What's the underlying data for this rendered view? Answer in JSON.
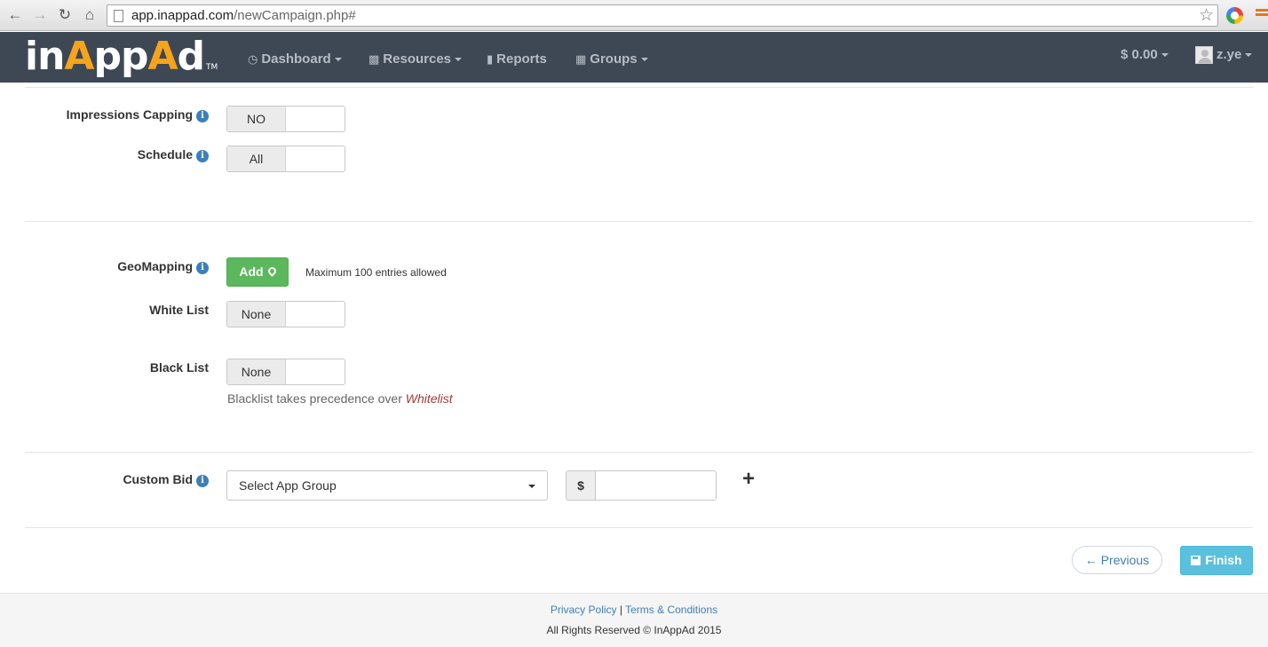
{
  "browser": {
    "url_host": "app.inappad.com",
    "url_path": "/newCampaign.php#"
  },
  "navbar": {
    "logo_prefix": "in",
    "logo_accent": "A",
    "logo_mid": "pp",
    "logo_accent2": "A",
    "logo_suffix": "d",
    "logo_tm": "TM",
    "items": [
      {
        "label": "Dashboard",
        "icon": "clock-icon"
      },
      {
        "label": "Resources",
        "icon": "book-icon"
      },
      {
        "label": "Reports",
        "icon": "bar-chart-icon"
      },
      {
        "label": "Groups",
        "icon": "grid-icon"
      }
    ],
    "balance": "$ 0.00",
    "username": "z.ye",
    "colors": {
      "bar": "#3e4855",
      "accent": "#f5a41b"
    }
  },
  "form": {
    "impressions_capping": {
      "label": "Impressions Capping",
      "value": "NO"
    },
    "schedule": {
      "label": "Schedule",
      "value": "All"
    },
    "geomapping": {
      "label": "GeoMapping",
      "add_label": "Add",
      "help": "Maximum 100 entries allowed"
    },
    "white_list": {
      "label": "White List",
      "value": "None"
    },
    "black_list": {
      "label": "Black List",
      "value": "None"
    },
    "note_prefix": "Blacklist takes precedence over ",
    "note_emph": "Whitelist",
    "custom_bid": {
      "label": "Custom Bid",
      "select_value": "Select App Group",
      "currency": "$",
      "amount": "",
      "add_symbol": "+"
    }
  },
  "actions": {
    "previous": "← Previous",
    "finish": "Finish"
  },
  "footer": {
    "privacy": "Privacy Policy",
    "separator": " | ",
    "terms": "Terms & Conditions",
    "copyright": "All Rights Reserved © InAppAd 2015"
  }
}
